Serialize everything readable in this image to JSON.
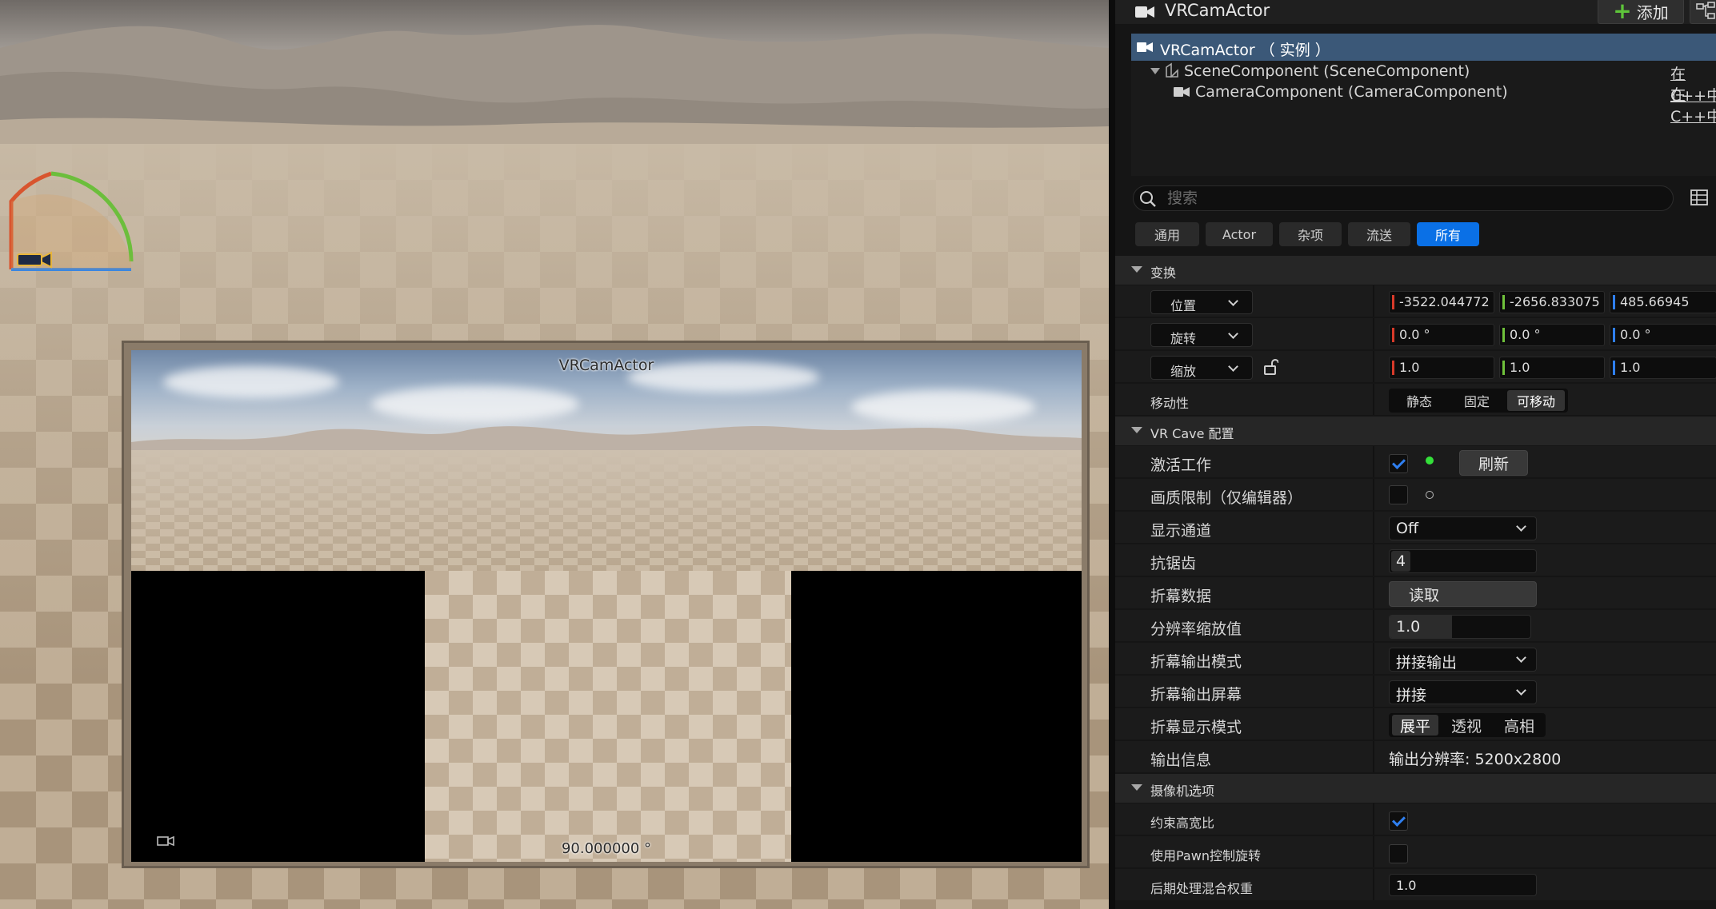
{
  "viewport": {
    "preview_title": "VRCamActor",
    "preview_fov": "90.000000 °"
  },
  "panel": {
    "header": {
      "title": "VRCamActor",
      "add_label": "添加"
    },
    "tree": [
      {
        "label": "VRCamActor （ 实例 ）",
        "cpp": ""
      },
      {
        "label": "SceneComponent (SceneComponent)",
        "cpp": "在C++中"
      },
      {
        "label": "CameraComponent (CameraComponent)",
        "cpp": "在C++中"
      }
    ],
    "search": {
      "placeholder": "搜索"
    },
    "tabs": [
      "通用",
      "Actor",
      "杂项",
      "流送",
      "所有"
    ],
    "transform": {
      "section": "变换",
      "location": {
        "label": "位置",
        "x": "-3522.044772",
        "y": "-2656.833075",
        "z": "485.66945"
      },
      "rotation": {
        "label": "旋转",
        "x": "0.0 °",
        "y": "0.0 °",
        "z": "0.0 °"
      },
      "scale": {
        "label": "缩放",
        "x": "1.0",
        "y": "1.0",
        "z": "1.0"
      },
      "mobility": {
        "label": "移动性",
        "options": [
          "静态",
          "固定",
          "可移动"
        ],
        "selected": "可移动"
      }
    },
    "vrcave": {
      "section": "VR Cave 配置",
      "activate": {
        "label": "激活工作",
        "refresh": "刷新"
      },
      "quality_limit": {
        "label": "画质限制（仅编辑器）"
      },
      "display_channel": {
        "label": "显示通道",
        "value": "Off"
      },
      "antialias": {
        "label": "抗锯齿",
        "value": "4"
      },
      "fold_data": {
        "label": "折幕数据",
        "button": "读取"
      },
      "res_scale": {
        "label": "分辨率缩放值",
        "value": "1.0"
      },
      "fold_output_mode": {
        "label": "折幕输出模式",
        "value": "拼接输出"
      },
      "fold_output_screen": {
        "label": "折幕输出屏幕",
        "value": "拼接"
      },
      "fold_display_mode": {
        "label": "折幕显示模式",
        "options": [
          "展平",
          "透视",
          "高相"
        ],
        "selected": "展平"
      },
      "output_info": {
        "label": "输出信息",
        "value": "输出分辨率: 5200x2800"
      }
    },
    "camera_options": {
      "section": "摄像机选项",
      "constrain_aspect": {
        "label": "约束高宽比"
      },
      "use_pawn_rotation": {
        "label": "使用Pawn控制旋转"
      },
      "postprocess_weight": {
        "label": "后期处理混合权重",
        "value": "1.0"
      }
    }
  },
  "colors": {
    "accent": "#0a70e6",
    "selected_row": "#3b5878",
    "axis_x": "#d83a2a",
    "axis_y": "#6fc23b",
    "axis_z": "#2f7ff0"
  }
}
